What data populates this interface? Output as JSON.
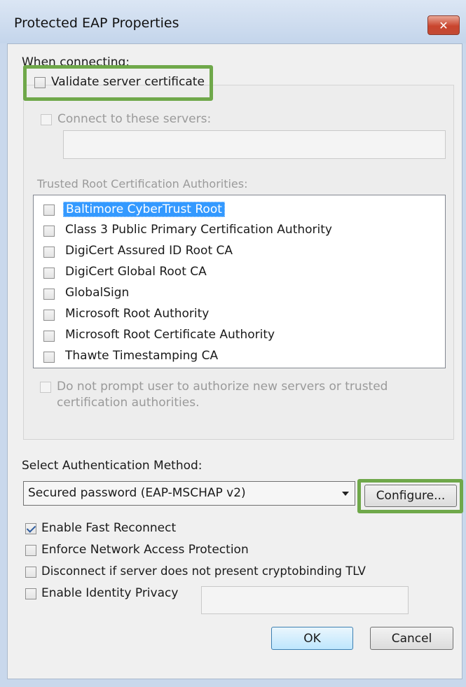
{
  "window": {
    "title": "Protected EAP Properties",
    "close_glyph": "✕"
  },
  "connecting": {
    "heading": "When connecting:",
    "validate_label": "Validate server certificate",
    "connect_label": "Connect to these servers:",
    "servers_value": "",
    "trusted_heading": "Trusted Root Certification Authorities:",
    "authorities": [
      "Baltimore CyberTrust Root",
      "Class 3 Public Primary Certification Authority",
      "DigiCert Assured ID Root CA",
      "DigiCert Global Root CA",
      "GlobalSign",
      "Microsoft Root Authority",
      "Microsoft Root Certificate Authority",
      "Thawte Timestamping CA"
    ],
    "no_prompt_line1": "Do not prompt user to authorize new servers or trusted",
    "no_prompt_line2": "certification authorities."
  },
  "auth": {
    "heading": "Select Authentication Method:",
    "method": "Secured password (EAP-MSCHAP v2)",
    "configure_label": "Configure...",
    "fast_reconnect_label": "Enable Fast Reconnect",
    "nap_label": "Enforce Network Access Protection",
    "cryptobinding_label": "Disconnect if server does not present cryptobinding TLV",
    "identity_privacy_label": "Enable Identity Privacy",
    "identity_value": ""
  },
  "buttons": {
    "ok": "OK",
    "cancel": "Cancel"
  },
  "colors": {
    "highlight": "#6fa84a",
    "selection": "#3399ff"
  }
}
